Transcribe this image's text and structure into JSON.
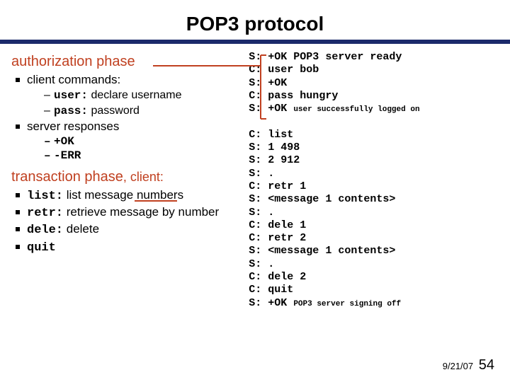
{
  "title": "POP3 protocol",
  "left": {
    "auth_heading": "authorization phase",
    "auth_items": {
      "cc": "client commands:",
      "user_cmd": "user:",
      "user_desc": " declare username",
      "pass_cmd": "pass:",
      "pass_desc": " password",
      "sr": "server responses",
      "ok": "+OK",
      "err": "-ERR"
    },
    "trans_heading_a": "transaction phase",
    "trans_heading_b": ", client:",
    "trans_items": {
      "list_cmd": "list:",
      "list_desc": " list message numbers",
      "retr_cmd": "retr:",
      "retr_desc": " retrieve message by number",
      "dele_cmd": "dele:",
      "dele_desc": " delete",
      "quit_cmd": "quit"
    }
  },
  "terminal": {
    "l1a": "S: +OK POP3 server ready",
    "l2": "C: user bob",
    "l3": "S: +OK",
    "l4": "C: pass hungry",
    "l5a": "S: +OK ",
    "l5b": "user successfully logged on",
    "gap": " ",
    "l6": "C: list",
    "l7": "S: 1 498",
    "l8": "S: 2 912",
    "l9": "S: .",
    "l10": "C: retr 1",
    "l11": "S: <message 1 contents>",
    "l12": "S: .",
    "l13": "C: dele 1",
    "l14": "C: retr 2",
    "l15": "S: <message 1 contents>",
    "l16": "S: .",
    "l17": "C: dele 2",
    "l18": "C: quit",
    "l19a": "S: +OK ",
    "l19b": "POP3 server signing off"
  },
  "footer": {
    "date": "9/21/07",
    "page": "54"
  }
}
